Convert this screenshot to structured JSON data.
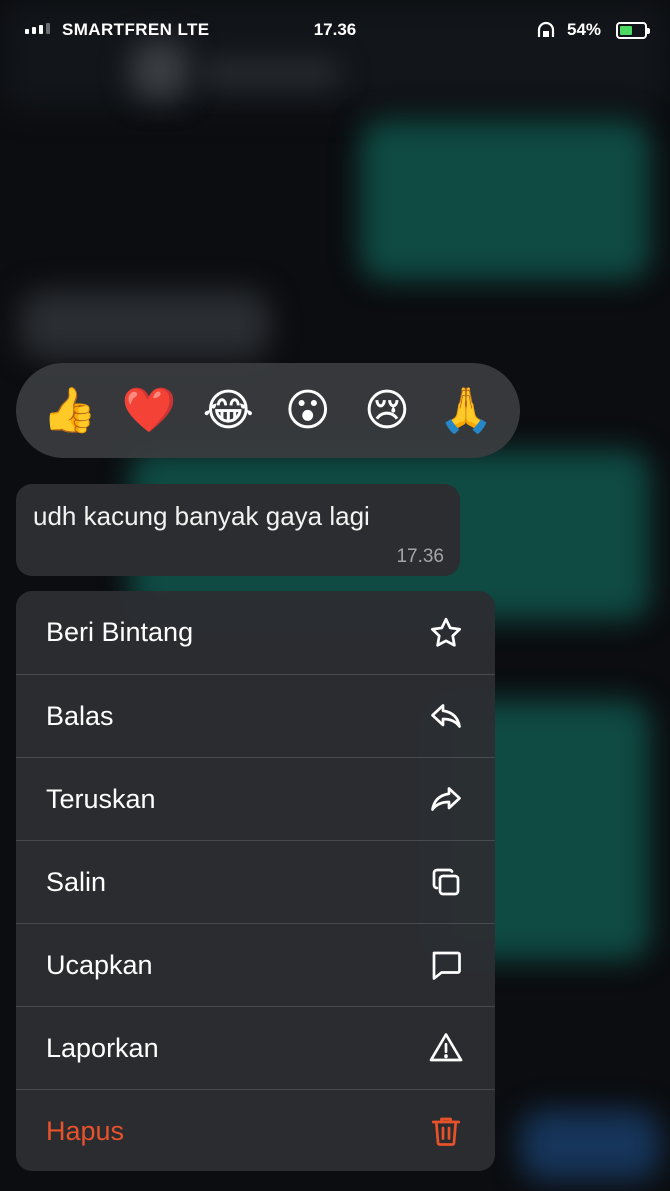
{
  "status_bar": {
    "carrier": "SMARTFREN  LTE",
    "time": "17.36",
    "battery_percent": "54%",
    "battery_level": 0.54,
    "signal_bars_filled": 3
  },
  "reactions": [
    {
      "emoji": "👍",
      "name": "thumbs-up"
    },
    {
      "emoji": "❤️",
      "name": "heart"
    },
    {
      "emoji": "😂",
      "name": "laughing-tears"
    },
    {
      "emoji": "😮",
      "name": "surprised"
    },
    {
      "emoji": "😢",
      "name": "crying"
    },
    {
      "emoji": "🙏",
      "name": "praying-hands"
    }
  ],
  "message": {
    "text": "udh kacung banyak gaya lagi",
    "time": "17.36"
  },
  "menu": {
    "star": {
      "label": "Beri Bintang",
      "icon": "star-icon"
    },
    "reply": {
      "label": "Balas",
      "icon": "reply-arrow-icon"
    },
    "forward": {
      "label": "Teruskan",
      "icon": "forward-arrow-icon"
    },
    "copy": {
      "label": "Salin",
      "icon": "copy-icon"
    },
    "speak": {
      "label": "Ucapkan",
      "icon": "speech-bubble-icon"
    },
    "report": {
      "label": "Laporkan",
      "icon": "warning-triangle-icon"
    },
    "delete": {
      "label": "Hapus",
      "icon": "trash-icon"
    }
  },
  "colors": {
    "delete": "#e8522b",
    "battery_fill": "#4cd964"
  }
}
